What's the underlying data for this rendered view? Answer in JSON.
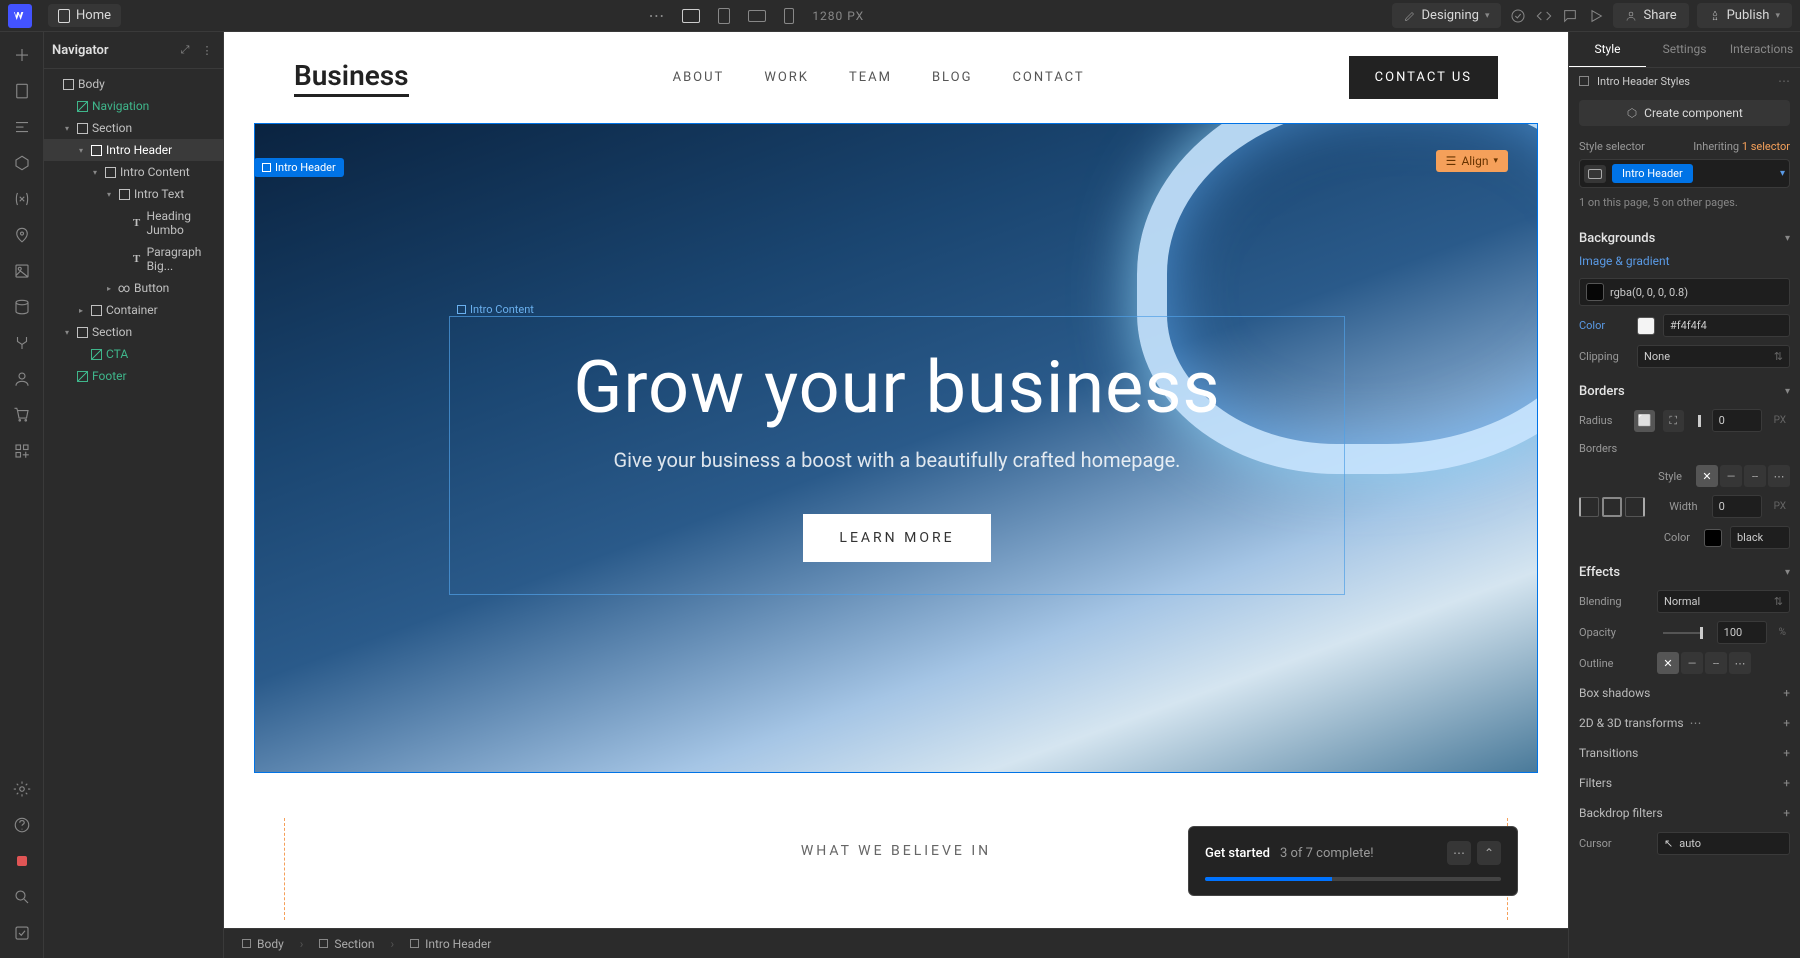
{
  "topbar": {
    "page_name": "Home",
    "canvas_px": "1280 PX",
    "mode_label": "Designing",
    "share": "Share",
    "publish": "Publish"
  },
  "navigator": {
    "title": "Navigator",
    "tree": [
      {
        "label": "Body",
        "indent": 0,
        "icon": "box",
        "toggle": ""
      },
      {
        "label": "Navigation",
        "indent": 1,
        "icon": "cube",
        "toggle": "",
        "comp": true
      },
      {
        "label": "Section",
        "indent": 1,
        "icon": "box",
        "toggle": "▾"
      },
      {
        "label": "Intro Header",
        "indent": 2,
        "icon": "box",
        "toggle": "▾",
        "selected": true
      },
      {
        "label": "Intro Content",
        "indent": 3,
        "icon": "box",
        "toggle": "▾"
      },
      {
        "label": "Intro Text",
        "indent": 4,
        "icon": "box",
        "toggle": "▾"
      },
      {
        "label": "Heading Jumbo",
        "indent": 5,
        "icon": "t",
        "toggle": ""
      },
      {
        "label": "Paragraph Big...",
        "indent": 5,
        "icon": "t",
        "toggle": ""
      },
      {
        "label": "Button",
        "indent": 4,
        "icon": "link",
        "toggle": "▸"
      },
      {
        "label": "Container",
        "indent": 2,
        "icon": "box",
        "toggle": "▸"
      },
      {
        "label": "Section",
        "indent": 1,
        "icon": "box",
        "toggle": "▾"
      },
      {
        "label": "CTA",
        "indent": 2,
        "icon": "cube",
        "toggle": "",
        "comp": true
      },
      {
        "label": "Footer",
        "indent": 1,
        "icon": "cube",
        "toggle": "",
        "comp": true
      }
    ]
  },
  "canvas": {
    "brand": "Business",
    "nav_links": [
      "ABOUT",
      "WORK",
      "TEAM",
      "BLOG",
      "CONTACT"
    ],
    "nav_cta": "CONTACT US",
    "sel_outer": "Intro Header",
    "sel_inner": "Intro Content",
    "align_badge": "Align",
    "hero_heading": "Grow your business",
    "hero_paragraph": "Give your business a boost with a beautifully crafted homepage.",
    "hero_button": "LEARN MORE",
    "below_hero": "WHAT WE BELIEVE IN"
  },
  "breadcrumb": [
    "Body",
    "Section",
    "Intro Header"
  ],
  "toast": {
    "title": "Get started",
    "subtitle": "3 of 7 complete!",
    "progress_pct": 43
  },
  "right_panel": {
    "tabs": [
      "Style",
      "Settings",
      "Interactions"
    ],
    "styles_breadcrumb": "Intro Header Styles",
    "create_component": "Create component",
    "selector_label": "Style selector",
    "inheriting_prefix": "Inheriting ",
    "inheriting_suffix": "1 selector",
    "selector_chip": "Intro Header",
    "instances": "1 on this page, 5 on other pages.",
    "sections": {
      "backgrounds": "Backgrounds",
      "image_gradient": "Image & gradient",
      "bg_value": "rgba(0, 0, 0, 0.8)",
      "color_label": "Color",
      "color_value": "#f4f4f4",
      "clipping_label": "Clipping",
      "clipping_value": "None",
      "borders": "Borders",
      "radius_label": "Radius",
      "radius_value": "0",
      "radius_unit": "PX",
      "borders_sub": "Borders",
      "style_label": "Style",
      "width_label": "Width",
      "width_value": "0",
      "width_unit": "PX",
      "bcolor_label": "Color",
      "bcolor_value": "black",
      "effects": "Effects",
      "blending_label": "Blending",
      "blending_value": "Normal",
      "opacity_label": "Opacity",
      "opacity_value": "100",
      "opacity_unit": "%",
      "outline_label": "Outline",
      "box_shadows": "Box shadows",
      "transforms": "2D & 3D transforms",
      "transitions": "Transitions",
      "filters": "Filters",
      "backdrop": "Backdrop filters",
      "cursor_label": "Cursor",
      "cursor_value": "auto"
    }
  }
}
